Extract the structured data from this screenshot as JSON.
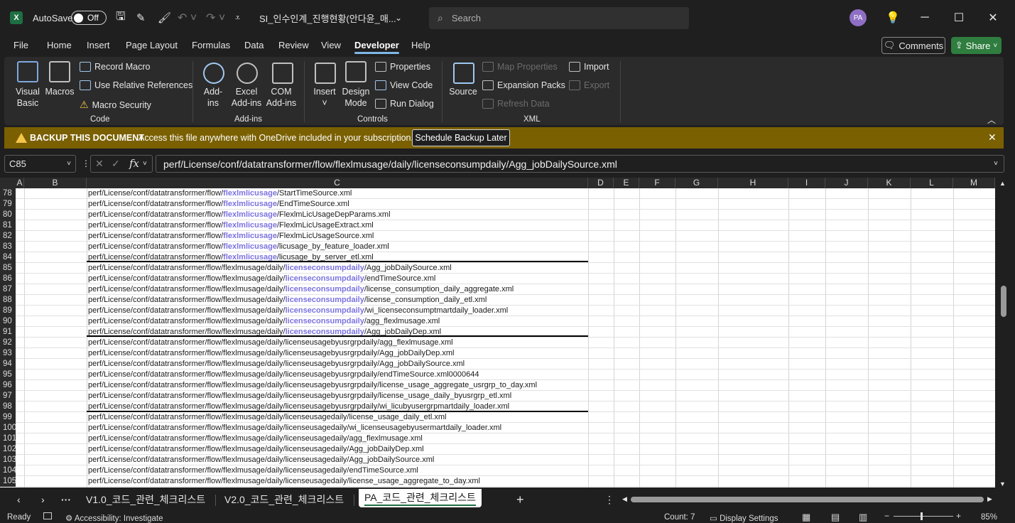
{
  "title_bar": {
    "autosave_label": "AutoSave",
    "autosave_state": "Off",
    "file_name": "SI_인수인계_진행현황(안다윤_매...",
    "search_placeholder": "Search",
    "avatar_initials": "PA"
  },
  "menu": [
    "File",
    "Home",
    "Insert",
    "Page Layout",
    "Formulas",
    "Data",
    "Review",
    "View",
    "Developer",
    "Help"
  ],
  "active_menu": "Developer",
  "buttons": {
    "comments": "Comments",
    "share": "Share"
  },
  "ribbon": {
    "code": {
      "group_label": "Code",
      "visual_basic": "Visual Basic",
      "macros": "Macros",
      "record_macro": "Record Macro",
      "use_relative": "Use Relative References",
      "macro_security": "Macro Security"
    },
    "addins": {
      "group_label": "Add-ins",
      "addins": "Add-ins",
      "excel_addins": "Excel Add-ins",
      "com_addins": "COM Add-ins"
    },
    "controls": {
      "group_label": "Controls",
      "insert": "Insert",
      "design_mode": "Design Mode",
      "properties": "Properties",
      "view_code": "View Code",
      "run_dialog": "Run Dialog"
    },
    "xml": {
      "group_label": "XML",
      "source": "Source",
      "map_properties": "Map Properties",
      "expansion_packs": "Expansion Packs",
      "refresh_data": "Refresh Data",
      "import": "Import",
      "export": "Export"
    }
  },
  "message_bar": {
    "title": "BACKUP THIS DOCUMENT",
    "text": "Access this file anywhere with OneDrive included in your subscription.",
    "button": "Schedule Backup Later"
  },
  "formula_bar": {
    "name_box": "C85",
    "formula": "perf/License/conf/datatransformer/flow/flexlmusage/daily/licenseconsumpdaily/Agg_jobDailySource.xml"
  },
  "columns": [
    "A",
    "B",
    "C",
    "D",
    "E",
    "F",
    "G",
    "H",
    "I",
    "J",
    "K",
    "L",
    "M"
  ],
  "rows": [
    {
      "n": "78",
      "pre": "perf/License/conf/datatransformer/flow/",
      "hl": "flexlmlicusage",
      "post": "/StartTimeSource.xml"
    },
    {
      "n": "79",
      "pre": "perf/License/conf/datatransformer/flow/",
      "hl": "flexlmlicusage",
      "post": "/EndTimeSource.xml"
    },
    {
      "n": "80",
      "pre": "perf/License/conf/datatransformer/flow/",
      "hl": "flexlmlicusage",
      "post": "/FlexlmLicUsageDepParams.xml"
    },
    {
      "n": "81",
      "pre": "perf/License/conf/datatransformer/flow/",
      "hl": "flexlmlicusage",
      "post": "/FlexlmLicUsageExtract.xml"
    },
    {
      "n": "82",
      "pre": "perf/License/conf/datatransformer/flow/",
      "hl": "flexlmlicusage",
      "post": "/FlexlmLicUsageSource.xml"
    },
    {
      "n": "83",
      "pre": "perf/License/conf/datatransformer/flow/",
      "hl": "flexlmlicusage",
      "post": "/licusage_by_feature_loader.xml"
    },
    {
      "n": "84",
      "pre": "perf/License/conf/datatransformer/flow/",
      "hl": "flexlmlicusage",
      "post": "/licusage_by_server_etl.xml"
    },
    {
      "n": "85",
      "pre": "perf/License/conf/datatransformer/flow/flexlmusage/daily/",
      "hl": "licenseconsumpdaily",
      "post": "/Agg_jobDailySource.xml"
    },
    {
      "n": "86",
      "pre": "perf/License/conf/datatransformer/flow/flexlmusage/daily/",
      "hl": "licenseconsumpdaily",
      "post": "/endTimeSource.xml"
    },
    {
      "n": "87",
      "pre": "perf/License/conf/datatransformer/flow/flexlmusage/daily/",
      "hl": "licenseconsumpdaily",
      "post": "/license_consumption_daily_aggregate.xml"
    },
    {
      "n": "88",
      "pre": "perf/License/conf/datatransformer/flow/flexlmusage/daily/",
      "hl": "licenseconsumpdaily",
      "post": "/license_consumption_daily_etl.xml"
    },
    {
      "n": "89",
      "pre": "perf/License/conf/datatransformer/flow/flexlmusage/daily/",
      "hl": "licenseconsumpdaily",
      "post": "/wi_licenseconsumptmartdaily_loader.xml"
    },
    {
      "n": "90",
      "pre": "perf/License/conf/datatransformer/flow/flexlmusage/daily/",
      "hl": "licenseconsumpdaily",
      "post": "/agg_flexlmusage.xml"
    },
    {
      "n": "91",
      "pre": "perf/License/conf/datatransformer/flow/flexlmusage/daily/",
      "hl": "licenseconsumpdaily",
      "post": "/Agg_jobDailyDep.xml"
    },
    {
      "n": "92",
      "pre": "perf/License/conf/datatransformer/flow/flexlmusage/daily/licenseusagebyusrgrpdaily/agg_flexlmusage.xml",
      "hl": "",
      "post": ""
    },
    {
      "n": "93",
      "pre": "perf/License/conf/datatransformer/flow/flexlmusage/daily/licenseusagebyusrgrpdaily/Agg_jobDailyDep.xml",
      "hl": "",
      "post": ""
    },
    {
      "n": "94",
      "pre": "perf/License/conf/datatransformer/flow/flexlmusage/daily/licenseusagebyusrgrpdaily/Agg_jobDailySource.xml",
      "hl": "",
      "post": ""
    },
    {
      "n": "95",
      "pre": "perf/License/conf/datatransformer/flow/flexlmusage/daily/licenseusagebyusrgrpdaily/endTimeSource.xml0000644",
      "hl": "",
      "post": ""
    },
    {
      "n": "96",
      "pre": "perf/License/conf/datatransformer/flow/flexlmusage/daily/licenseusagebyusrgrpdaily/license_usage_aggregate_usrgrp_to_day.xml",
      "hl": "",
      "post": ""
    },
    {
      "n": "97",
      "pre": "perf/License/conf/datatransformer/flow/flexlmusage/daily/licenseusagebyusrgrpdaily/license_usage_daily_byusrgrp_etl.xml",
      "hl": "",
      "post": ""
    },
    {
      "n": "98",
      "pre": "perf/License/conf/datatransformer/flow/flexlmusage/daily/licenseusagebyusrgrpdaily/wi_licubyusergrpmartdaily_loader.xml",
      "hl": "",
      "post": ""
    },
    {
      "n": "99",
      "pre": "perf/License/conf/datatransformer/flow/flexlmusage/daily/licenseusagedaily/license_usage_daily_etl.xml",
      "hl": "",
      "post": ""
    },
    {
      "n": "100",
      "pre": "perf/License/conf/datatransformer/flow/flexlmusage/daily/licenseusagedaily/wi_licenseusagebyusermartdaily_loader.xml",
      "hl": "",
      "post": ""
    },
    {
      "n": "101",
      "pre": "perf/License/conf/datatransformer/flow/flexlmusage/daily/licenseusagedaily/agg_flexlmusage.xml",
      "hl": "",
      "post": ""
    },
    {
      "n": "102",
      "pre": "perf/License/conf/datatransformer/flow/flexlmusage/daily/licenseusagedaily/Agg_jobDailyDep.xml",
      "hl": "",
      "post": ""
    },
    {
      "n": "103",
      "pre": "perf/License/conf/datatransformer/flow/flexlmusage/daily/licenseusagedaily/Agg_jobDailySource.xml",
      "hl": "",
      "post": ""
    },
    {
      "n": "104",
      "pre": "perf/License/conf/datatransformer/flow/flexlmusage/daily/licenseusagedaily/endTimeSource.xml",
      "hl": "",
      "post": ""
    },
    {
      "n": "105",
      "pre": "perf/License/conf/datatransformer/flow/flexlmusage/daily/licenseusagedaily/license_usage_aggregate_to_day.xml",
      "hl": "",
      "post": ""
    }
  ],
  "sheet_tabs": [
    "V1.0_코드_관련_체크리스트",
    "V2.0_코드_관련_체크리스트",
    "PA_코드_관련_체크리스트"
  ],
  "active_tab": "PA_코드_관련_체크리스트",
  "status": {
    "ready": "Ready",
    "accessibility": "Accessibility: Investigate",
    "count": "Count: 7",
    "display_settings": "Display Settings",
    "zoom": "85%"
  },
  "colors": {
    "accent": "#7b72e0",
    "excel_green": "#1d6f42",
    "message_bar": "#7a6000"
  }
}
